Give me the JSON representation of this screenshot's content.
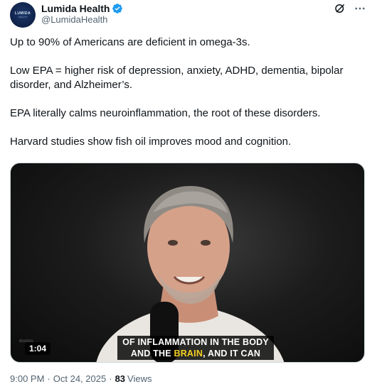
{
  "author": {
    "display_name": "Lumida Health",
    "handle": "@LumidaHealth",
    "verified": true,
    "avatar_text": "LUMIDA",
    "avatar_sub": "HEALTH"
  },
  "actions": {
    "grok_icon": "grok-icon",
    "more_icon": "more-icon"
  },
  "tweet": {
    "paragraphs": [
      "Up to 90% of Americans are deficient in omega-3s.",
      "Low EPA = higher risk of depression, anxiety, ADHD, dementia, bipolar disorder, and Alzheimer’s.",
      "EPA literally calms neuroinflammation, the root of these disorders.",
      "Harvard studies show fish oil improves mood and cognition."
    ]
  },
  "media": {
    "duration": "1:04",
    "caption_line1": "OF INFLAMMATION IN THE BODY",
    "caption_line2_pre": "AND THE ",
    "caption_line2_highlight": "BRAIN",
    "caption_line2_post": ", AND IT CAN",
    "watermark": "doctors"
  },
  "footer": {
    "time": "9:00 PM",
    "separator1": "·",
    "date": "Oct 24, 2025",
    "separator2": "·",
    "views_count": "83",
    "views_label": "Views"
  },
  "colors": {
    "text_primary": "#0f1419",
    "text_secondary": "#536471",
    "verified_blue": "#1d9bf0",
    "caption_highlight": "#f5d020"
  }
}
